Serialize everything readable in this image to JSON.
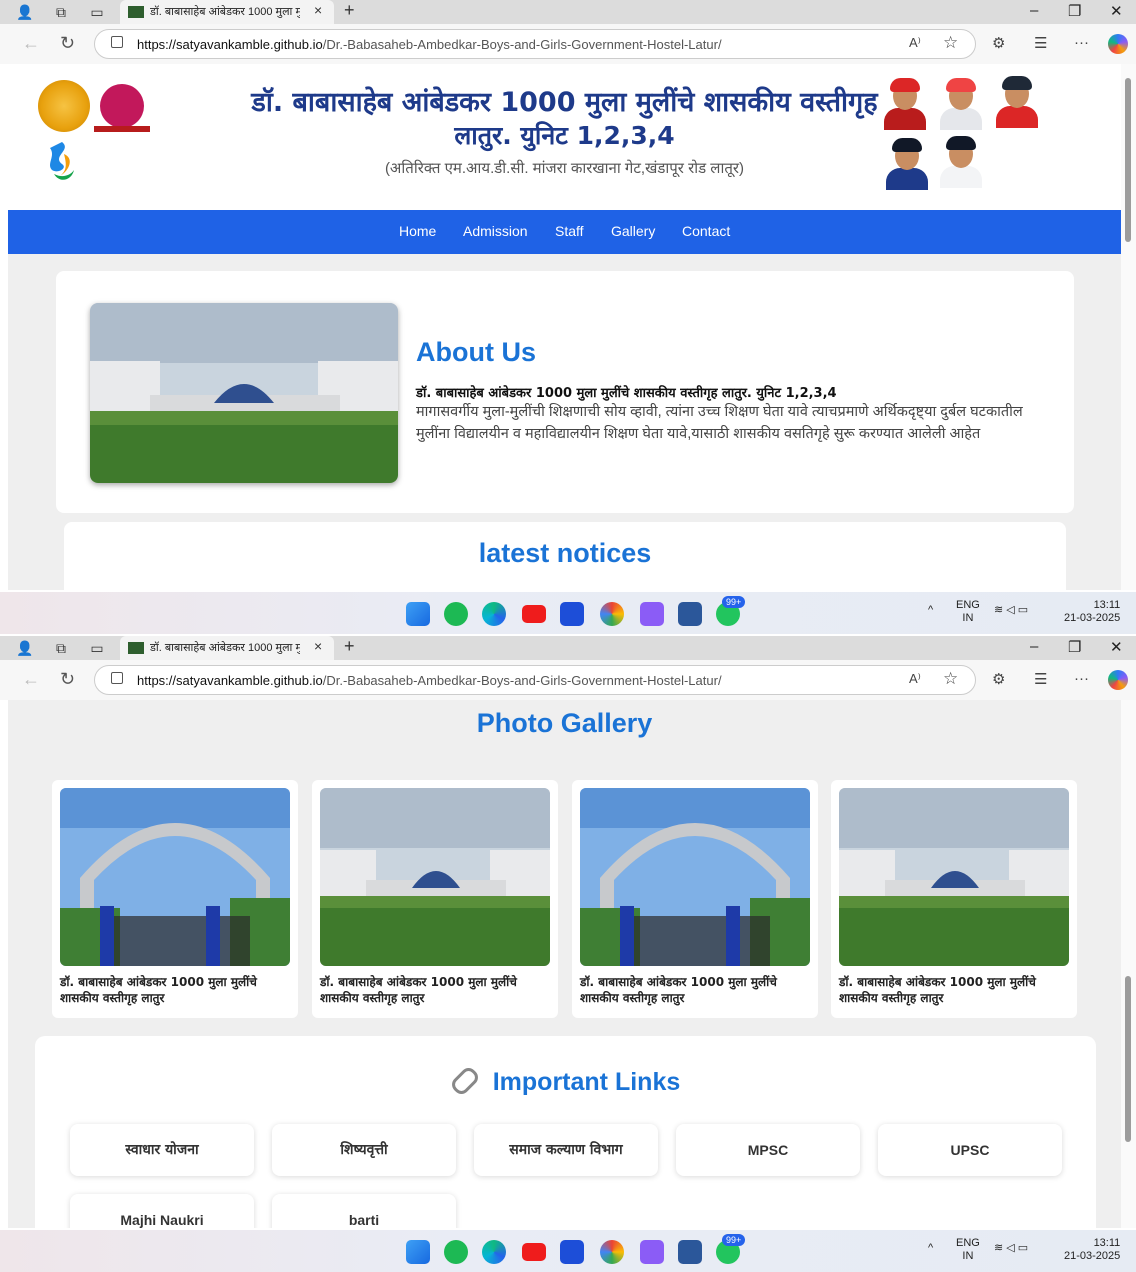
{
  "browser": {
    "tab_title": "डॉ. बाबासाहेब आंबेडकर 1000 मुला मु",
    "tab_close": "×",
    "new_tab": "+",
    "url_host": "https://satyavankamble.github.io",
    "url_path": "/Dr.-Babasaheb-Ambedkar-Boys-and-Girls-Government-Hostel-Latur/",
    "minimize": "–",
    "maximize": "❐",
    "close": "✕",
    "back": "←",
    "refresh": "↻",
    "read_aloud": "A⁾",
    "more": "···"
  },
  "header": {
    "title_line1": "डॉ. बाबासाहेब आंबेडकर 1000 मुला मुलींचे शासकीय वस्तीगृह",
    "title_line2": "लातुर. युनिट 1,2,3,4",
    "address": "(अतिरिक्त एम.आय.डी.सी. मांजरा कारखाना गेट,खंडापूर रोड लातूर)"
  },
  "nav": {
    "items": [
      "Home",
      "Admission",
      "Staff",
      "Gallery",
      "Contact"
    ]
  },
  "about": {
    "title": "About Us",
    "subtitle": "डॉ. बाबासाहेब आंबेडकर 1000 मुला मुलींचे शासकीय वस्तीगृह लातुर. युनिट 1,2,3,4",
    "body": "मागासवर्गीय मुला-मुलींची शिक्षणाची सोय व्हावी, त्यांना उच्च शिक्षण घेता यावे त्याचप्रमाणे अर्थिकदृष्ट्या दुर्बल घटकातील मुलींना विद्यालयीन व महाविद्यालयीन शिक्षण घेता यावे,यासाठी शासकीय वसतिगृहे सुरू करण्यात आलेली आहेत"
  },
  "notices": {
    "title": "latest notices"
  },
  "gallery": {
    "title": "Photo Gallery",
    "items": [
      {
        "caption": "डॉ. बाबासाहेब आंबेडकर 1000 मुला मुलींचे शासकीय वस्तीगृह लातुर",
        "kind": "gate"
      },
      {
        "caption": "डॉ. बाबासाहेब आंबेडकर 1000 मुला मुलींचे शासकीय वस्तीगृह लातुर",
        "kind": "building"
      },
      {
        "caption": "डॉ. बाबासाहेब आंबेडकर 1000 मुला मुलींचे शासकीय वस्तीगृह लातुर",
        "kind": "gate"
      },
      {
        "caption": "डॉ. बाबासाहेब आंबेडकर 1000 मुला मुलींचे शासकीय वस्तीगृह लातुर",
        "kind": "building"
      }
    ]
  },
  "links": {
    "title": "Important Links",
    "items": [
      "स्वाधार योजना",
      "शिष्यवृत्ती",
      "समाज कल्याण विभाग",
      "MPSC",
      "UPSC",
      "Majhi Naukri",
      "barti"
    ]
  },
  "taskbar": {
    "badge": "99+",
    "lang1": "ENG",
    "lang2": "IN",
    "time": "13:11",
    "date": "21-03-2025",
    "chevron": "^"
  },
  "colors": {
    "nav_blue": "#1f62e6",
    "heading_blue": "#1a73d6",
    "title_navy": "#1e3a8a"
  }
}
